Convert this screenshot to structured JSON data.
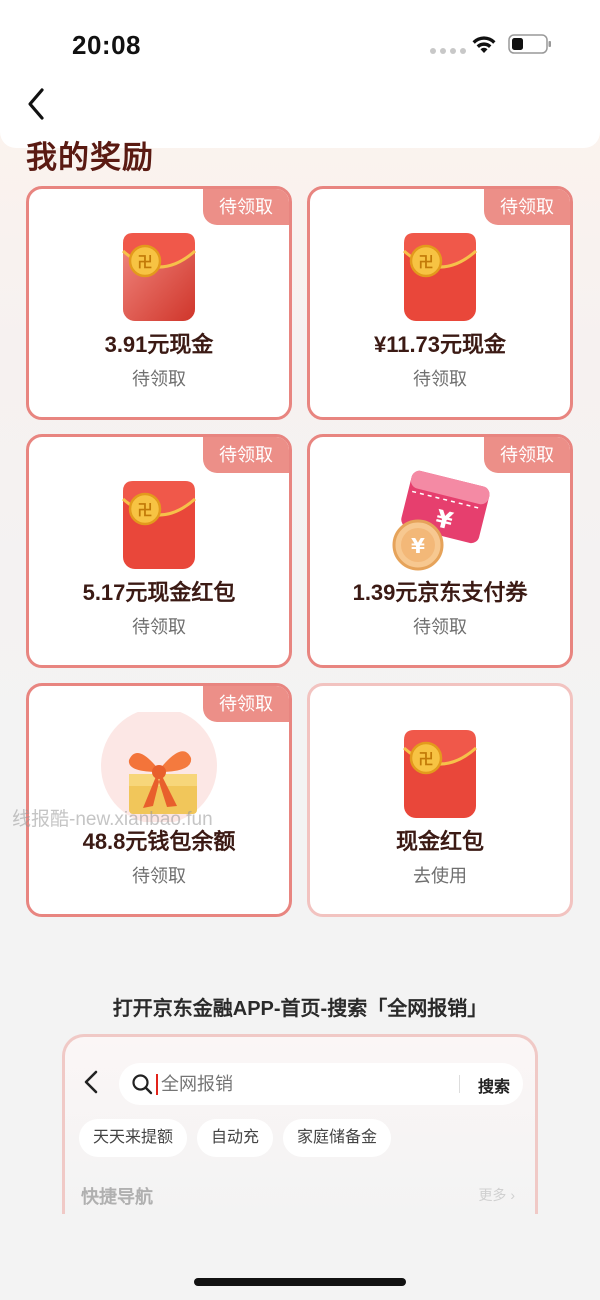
{
  "status_bar": {
    "time": "20:08"
  },
  "page": {
    "title": "我的奖励"
  },
  "rewards": [
    {
      "title": "3.91元现金",
      "status": "待领取",
      "badge": "待领取",
      "icon": "red-envelope-icon"
    },
    {
      "title": "¥11.73元现金",
      "status": "待领取",
      "badge": "待领取",
      "icon": "red-envelope-icon"
    },
    {
      "title": "5.17元现金红包",
      "status": "待领取",
      "badge": "待领取",
      "icon": "red-envelope-icon"
    },
    {
      "title": "1.39元京东支付券",
      "status": "待领取",
      "badge": "待领取",
      "icon": "payment-coupon-icon"
    },
    {
      "title": "48.8元钱包余额",
      "status": "待领取",
      "badge": "待领取",
      "icon": "gift-box-icon"
    },
    {
      "title": "现金红包",
      "status": "去使用",
      "badge": "",
      "icon": "red-envelope-icon"
    }
  ],
  "watermark": "线报酷-new.xianbao.fun",
  "instruction": "打开京东金融APP-首页-搜索「全网报销」",
  "preview": {
    "search_placeholder": "全网报销",
    "search_button": "搜索",
    "chips": [
      "天天来提额",
      "自动充",
      "家庭储备金"
    ],
    "section_title": "快捷导航",
    "more_label": "更多 ›"
  },
  "colors": {
    "accent": "#ec8f88",
    "card_border": "#e88580",
    "title_brown": "#5a1a12"
  }
}
